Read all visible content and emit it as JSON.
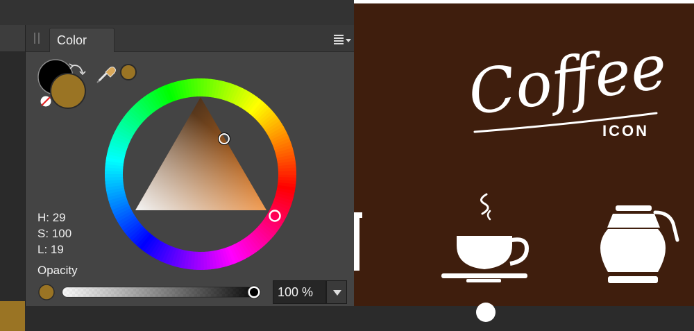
{
  "panel": {
    "tab_label": "Color",
    "menu_icon": "panel-menu-icon",
    "hsl": {
      "h": "H: 29",
      "s": "S: 100",
      "l": "L: 19"
    },
    "opacity_label": "Opacity",
    "opacity_value": "100 %"
  },
  "colors": {
    "fill": "#9a7424",
    "stroke": "#000000",
    "canvas_background": "#3f1e0d",
    "panel_background": "#444444"
  },
  "canvas": {
    "logo_text": "Coffee",
    "logo_subtext": "ICON"
  }
}
